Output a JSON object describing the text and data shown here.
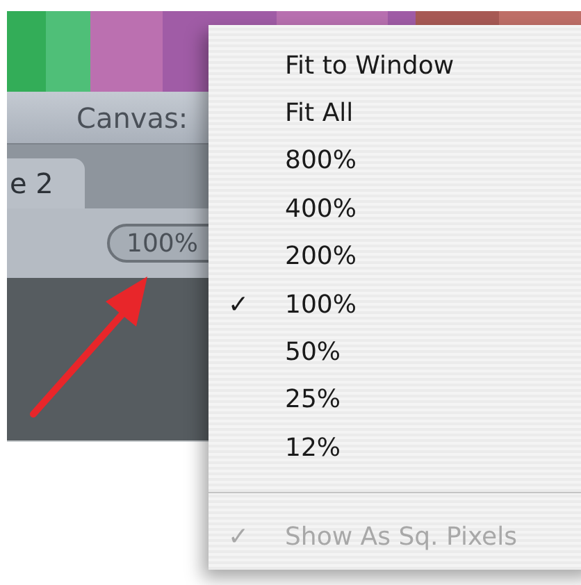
{
  "window": {
    "title": "Canvas:"
  },
  "tabs": [
    {
      "label": "e 2",
      "selected": true
    }
  ],
  "toolbar": {
    "zoom_value": "100%"
  },
  "zoom_menu": {
    "items": [
      {
        "kind": "item",
        "label": "Fit to Window",
        "checked": false,
        "disabled": false
      },
      {
        "kind": "item",
        "label": "Fit All",
        "checked": false,
        "disabled": false
      },
      {
        "kind": "item",
        "label": "800%",
        "checked": false,
        "disabled": false
      },
      {
        "kind": "item",
        "label": "400%",
        "checked": false,
        "disabled": false
      },
      {
        "kind": "item",
        "label": "200%",
        "checked": false,
        "disabled": false
      },
      {
        "kind": "item",
        "label": "100%",
        "checked": true,
        "disabled": false,
        "check_mark": "✓"
      },
      {
        "kind": "item",
        "label": "50%",
        "checked": false,
        "disabled": false
      },
      {
        "kind": "item",
        "label": "25%",
        "checked": false,
        "disabled": false
      },
      {
        "kind": "item",
        "label": "12%",
        "checked": false,
        "disabled": false
      },
      {
        "kind": "separator"
      },
      {
        "kind": "item",
        "label": "Show As Sq. Pixels",
        "checked": true,
        "disabled": true,
        "check_mark": "✓"
      }
    ]
  }
}
